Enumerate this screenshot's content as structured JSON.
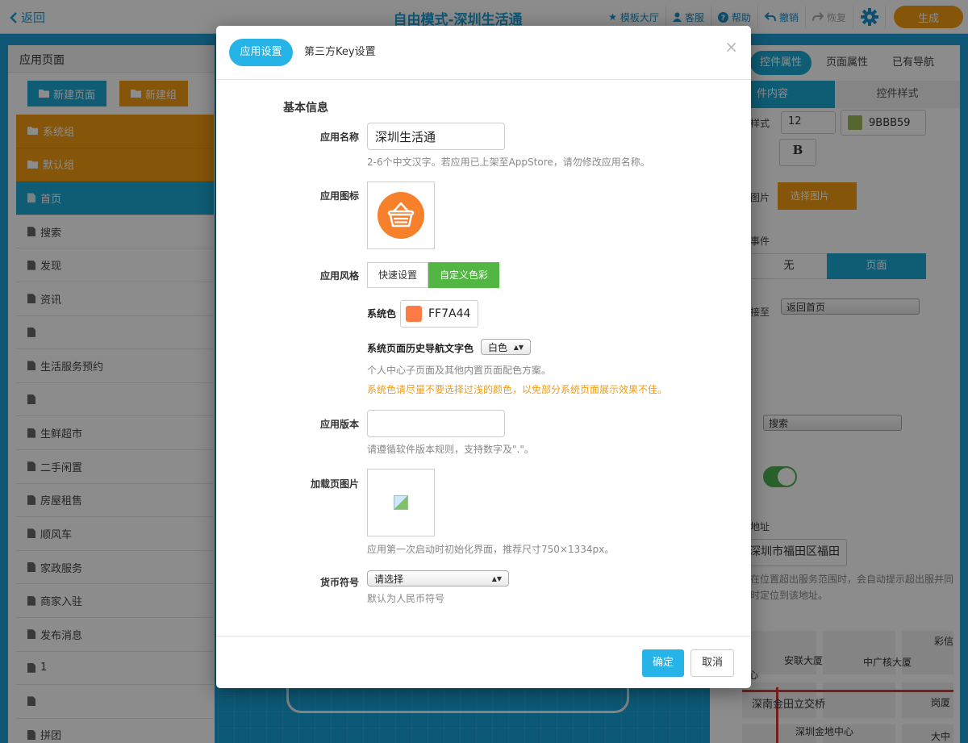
{
  "topbar": {
    "back_label": "返回",
    "title": "自由模式-深圳生活通",
    "actions": [
      {
        "label": "模板大厅",
        "icon": "star-icon"
      },
      {
        "label": "客服",
        "icon": "user-icon"
      },
      {
        "label": "帮助",
        "icon": "help-icon"
      },
      {
        "label": "撤销",
        "icon": "undo-icon"
      },
      {
        "label": "恢复",
        "icon": "redo-icon"
      }
    ],
    "generate_label": "生成"
  },
  "left_panel": {
    "title": "应用页面",
    "new_page_label": "新建页面",
    "new_group_label": "新建组",
    "items": [
      {
        "label": "系统组",
        "type": "group"
      },
      {
        "label": "默认组",
        "type": "group"
      },
      {
        "label": "首页",
        "type": "active"
      },
      {
        "label": "搜索",
        "type": "page"
      },
      {
        "label": "发现",
        "type": "page"
      },
      {
        "label": "资讯",
        "type": "page"
      },
      {
        "label": "",
        "type": "page"
      },
      {
        "label": "生活服务预约",
        "type": "page"
      },
      {
        "label": "",
        "type": "page"
      },
      {
        "label": "生鲜超市",
        "type": "page"
      },
      {
        "label": "二手闲置",
        "type": "page"
      },
      {
        "label": "房屋租售",
        "type": "page"
      },
      {
        "label": "顺风车",
        "type": "page"
      },
      {
        "label": "家政服务",
        "type": "page"
      },
      {
        "label": "商家入驻",
        "type": "page"
      },
      {
        "label": "发布消息",
        "type": "page"
      },
      {
        "label": "1",
        "type": "page"
      },
      {
        "label": "",
        "type": "page"
      },
      {
        "label": "拼团",
        "type": "page"
      }
    ]
  },
  "right_panel": {
    "tabs": [
      "控件属性",
      "页面属性",
      "已有导航"
    ],
    "subtabs": [
      "件内容",
      "控件样式"
    ],
    "style_label": "样式",
    "font_size": "12",
    "color_hex": "9BBB59",
    "bold_label": "B",
    "image_label": "图片",
    "choose_image_label": "选择图片",
    "event_label": "事件",
    "event_none": "无",
    "event_page": "页面",
    "link_label": "接至",
    "link_value": "返回首页",
    "search_select": "搜索",
    "address_label": "地址",
    "address_value": "深圳市福田区福田",
    "address_hint": "在位置超出服务范围时，会自动提示超出服并同时定位到该地址。",
    "map_labels": [
      "安联大厦",
      "中广核大厦",
      "深南金田立交桥",
      "深圳金地中心",
      "岗厦",
      "彩信",
      "心",
      "大中"
    ]
  },
  "modal": {
    "tab_active": "应用设置",
    "tab_inactive": "第三方Key设置",
    "close_label": "×",
    "section_title": "基本信息",
    "app_name_label": "应用名称",
    "app_name_value": "深圳生活通",
    "app_name_help": "2-6个中文汉字。若应用已上架至AppStore，请勿修改应用名称。",
    "app_icon_label": "应用图标",
    "app_style_label": "应用风格",
    "style_quick": "快速设置",
    "style_custom": "自定义色彩",
    "system_color_label": "系统色",
    "system_color_value": "FF7A44",
    "system_color_hex": "#FF7A44",
    "history_nav_label": "系统页面历史导航文字色",
    "history_nav_value": "白色",
    "history_nav_help": "个人中心子页面及其他内置页面配色方案。",
    "color_warning": "系统色请尽量不要选择过浅的颜色，以免部分系统页面展示效果不佳。",
    "version_label": "应用版本",
    "version_value": "",
    "version_help": "请遵循软件版本规则，支持数字及\".\"。",
    "splash_label": "加载页图片",
    "splash_help": "应用第一次启动时初始化界面，推荐尺寸750×1334px。",
    "currency_label": "货币符号",
    "currency_value": "请选择",
    "currency_help": "默认为人民币符号",
    "ok_label": "确定",
    "cancel_label": "取消"
  },
  "colors": {
    "accent_blue": "#26B3E8",
    "orange": "#F39C12",
    "green": "#52B742",
    "system_color": "#FF7A44",
    "swatch_green": "#9BBB59"
  }
}
